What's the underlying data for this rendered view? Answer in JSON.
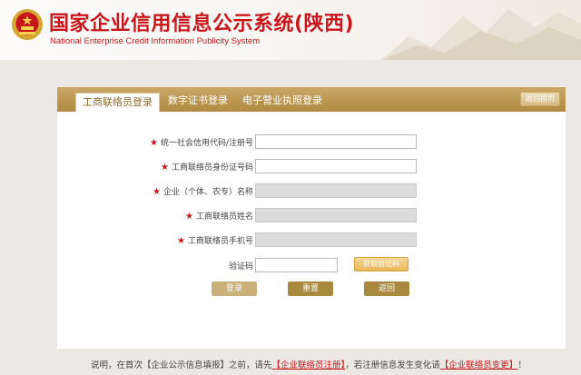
{
  "header": {
    "title": "国家企业信用信息公示系统(陕西)",
    "subtitle": "National Enterprise Credit Information Publicity System"
  },
  "tabs": [
    {
      "label": "工商联络员登录",
      "active": true
    },
    {
      "label": "数字证书登录",
      "active": false
    },
    {
      "label": "电子营业执照登录",
      "active": false
    }
  ],
  "home_button": "返回首页",
  "form": {
    "required_mark": "★",
    "fields": [
      {
        "label": "统一社会信用代码/注册号",
        "value": "",
        "disabled": false
      },
      {
        "label": "工商联络员身份证号码",
        "value": "",
        "disabled": false
      },
      {
        "label": "企业（个体、农专）名称",
        "value": "",
        "disabled": true
      },
      {
        "label": "工商联络员姓名",
        "value": "",
        "disabled": true
      },
      {
        "label": "工商联络员手机号",
        "value": "",
        "disabled": true
      }
    ],
    "captcha_label": "验证码",
    "captcha_value": "",
    "sms_button": "获取验证码"
  },
  "actions": {
    "login": "登录",
    "reset": "重置",
    "back": "返回"
  },
  "note": {
    "prefix": "说明，在首次【企业公示信息填报】之前，请先",
    "link1": "【企业联络员注册】",
    "middle": "，若注册信息发生变化请",
    "link2": "【企业联络员变更】",
    "suffix": "！"
  },
  "colors": {
    "brand_red": "#c8161d",
    "tab_gold": "#b08a43",
    "button_gold": "#a8893f"
  }
}
